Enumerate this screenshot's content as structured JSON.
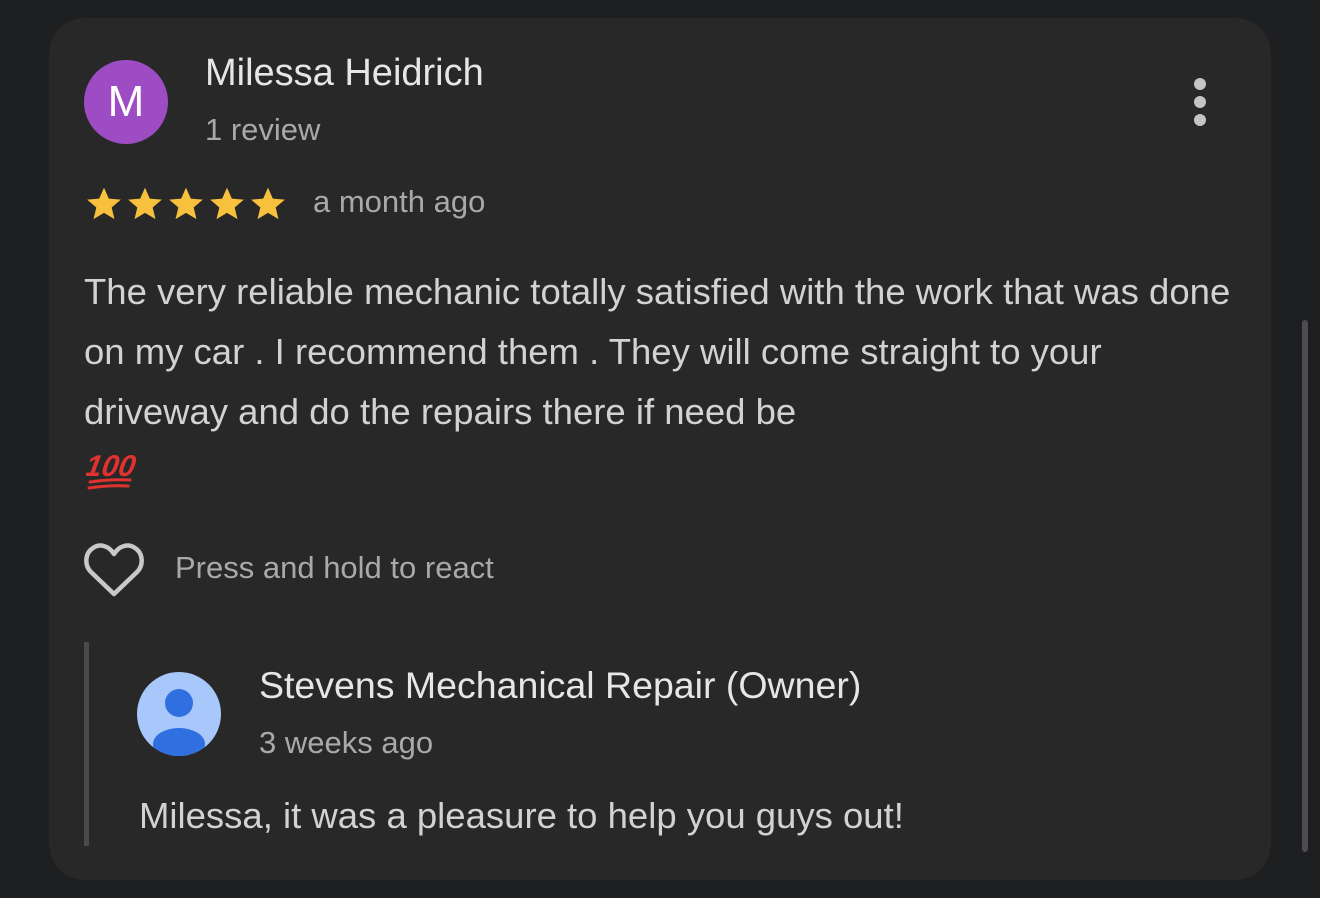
{
  "review": {
    "avatar_letter": "M",
    "avatar_color": "#9e4cc4",
    "reviewer_name": "Milessa Heidrich",
    "review_count": "1 review",
    "rating": 5,
    "rating_max": 5,
    "star_color": "#f7c13e",
    "date": "a month ago",
    "text": "The very reliable mechanic totally satisfied with the work that was done on my car . I recommend them . They will come straight to your driveway and do the repairs there if need be",
    "emoji": "100",
    "menu_icon": "more-vert-icon"
  },
  "reaction": {
    "icon": "heart-outline-icon",
    "hint": "Press and hold to react"
  },
  "owner_reply": {
    "avatar_icon": "person-icon",
    "avatar_color": "#a8c7fa",
    "name": "Stevens Mechanical Repair (Owner)",
    "date": "3 weeks ago",
    "text": "Milessa, it was a pleasure to help you guys out!"
  }
}
